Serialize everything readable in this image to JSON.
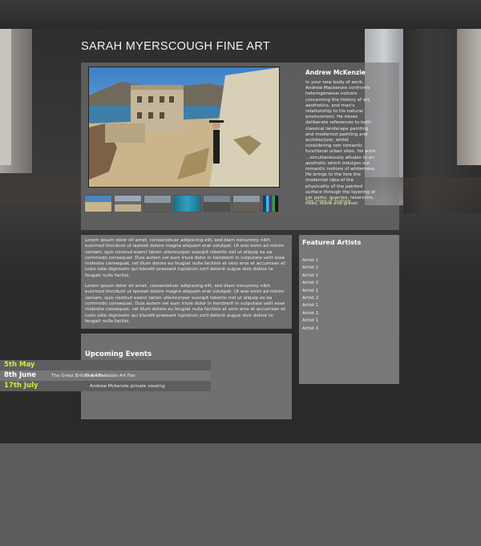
{
  "site": {
    "title": "SARAH MYERSCOUGH FINE ART"
  },
  "feature": {
    "artist": "Andrew McKenzie",
    "body": "In your new body of work, Andrew Mackenzie confronts heterogeneous notions concerning the history of art, aesthetics, and man's relationship to his natural environment. He mixes deliberate references to both classical landscape painting and modernist painting and architecture; whilst considering non romantic functional urban sites, his work …simultaneously alludes to an aesthetic which indulges our romantic notions of wilderness. He brings to the fore the modernist idea of the physicality of the painted surface through the layering of car parks, quarries, reservoirs, trees, stone and gravel.",
    "more_link": "See more of Andrew",
    "thumbs": [
      "thumb-1",
      "thumb-2",
      "thumb-3",
      "thumb-4",
      "thumb-5",
      "thumb-6",
      "thumb-7"
    ]
  },
  "lorem": {
    "p1": "Lorem ipsum dolor sit amet, consectetuer adipiscing elit, sed diam nonummy nibh euismod tincidunt ut laoreet dolore magna aliquam erat volutpat. Ut wisi enim ad minim veniam, quis nostrud exerci tation ullamcorper suscipit lobortis nisl ut aliquip ex ea commodo consequat. Duis autem vel eum iriure dolor in hendrerit in vulputate velit esse molestie consequat, vel illum dolore eu feugiat nulla facilisis at vero eros et accumsan et iusto odio dignissim qui blandit praesent luptatum zzril delenit augue duis dolore te feugait nulla facilisi.",
    "p2": "Lorem ipsum dolor sit amet, consectetuer adipiscing elit, sed diam nonummy nibh euismod tincidunt ut laoreet dolore magna aliquam erat volutpat. Ut wisi enim ad minim veniam, quis nostrud exerci tation ullamcorper suscipit lobortis nisl ut aliquip ex ea commodo consequat. Duis autem vel eum iriure dolor in hendrerit in vulputate velit esse molestie consequat, vel illum dolore eu feugiat nulla facilisis at vero eros et accumsan et iusto odio dignissim qui blandit praesent luptatum zzril delenit augue duis dolore te feugait nulla facilisi."
  },
  "artists": {
    "heading": "Featured Artists",
    "items": [
      "Artist 1",
      "Artist 2",
      "Artist 1",
      "Artist 2",
      "Artist 1",
      "Artist 2",
      "Artist 1",
      "Artist 2",
      "Artist 1",
      "Artist 2"
    ]
  },
  "events": {
    "heading": "Upcoming Events",
    "rows": [
      {
        "date": "5th May",
        "desc": ""
      },
      {
        "date": "8th June",
        "desc": "The Great British Art Fair",
        "desc2": "The Affordable Art Fair"
      },
      {
        "date": "17th July",
        "desc": "Andrew Mckenzie private viewing"
      }
    ]
  },
  "colors": {
    "accent": "#c9ee3e",
    "panel": "#707070"
  }
}
